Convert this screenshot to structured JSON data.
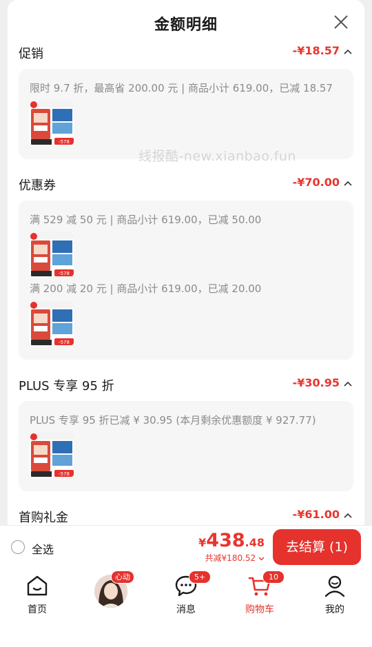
{
  "sheet": {
    "title": "金额明细",
    "watermark": "线报酷-new.xianbao.fun"
  },
  "sections": [
    {
      "title": "促销",
      "amount": "-¥18.57",
      "details": [
        "限时 9.7 折，最高省 200.00 元 | 商品小计 619.00，已减 18.57"
      ]
    },
    {
      "title": "优惠券",
      "amount": "-¥70.00",
      "details": [
        "满 529 减 50 元 | 商品小计 619.00，已减 50.00",
        "满 200 减 20 元 | 商品小计 619.00，已减 20.00"
      ]
    },
    {
      "title": "PLUS 专享 95 折",
      "amount": "-¥30.95",
      "details": [
        "PLUS 专享 95 折已减 ¥ 30.95 (本月剩余优惠额度 ¥ 927.77)"
      ]
    },
    {
      "title": "首购礼金",
      "amount": "-¥61.00",
      "details": []
    }
  ],
  "product_thumb": {
    "badge_text": "-578"
  },
  "bottom_bar": {
    "select_all_label": "全选",
    "total_currency": "¥",
    "total_int": "438",
    "total_dec": ".48",
    "saved_text": "共减¥180.52",
    "checkout_label": "去结算 (1)"
  },
  "tabbar": {
    "home_label": "首页",
    "avatar_badge": "心动",
    "messages_label": "消息",
    "messages_badge": "5+",
    "cart_label": "购物车",
    "cart_badge": "10",
    "me_label": "我的"
  },
  "colors": {
    "accent": "#e5322d",
    "amount": "#e8352e",
    "box_bg": "#f6f6f6"
  }
}
